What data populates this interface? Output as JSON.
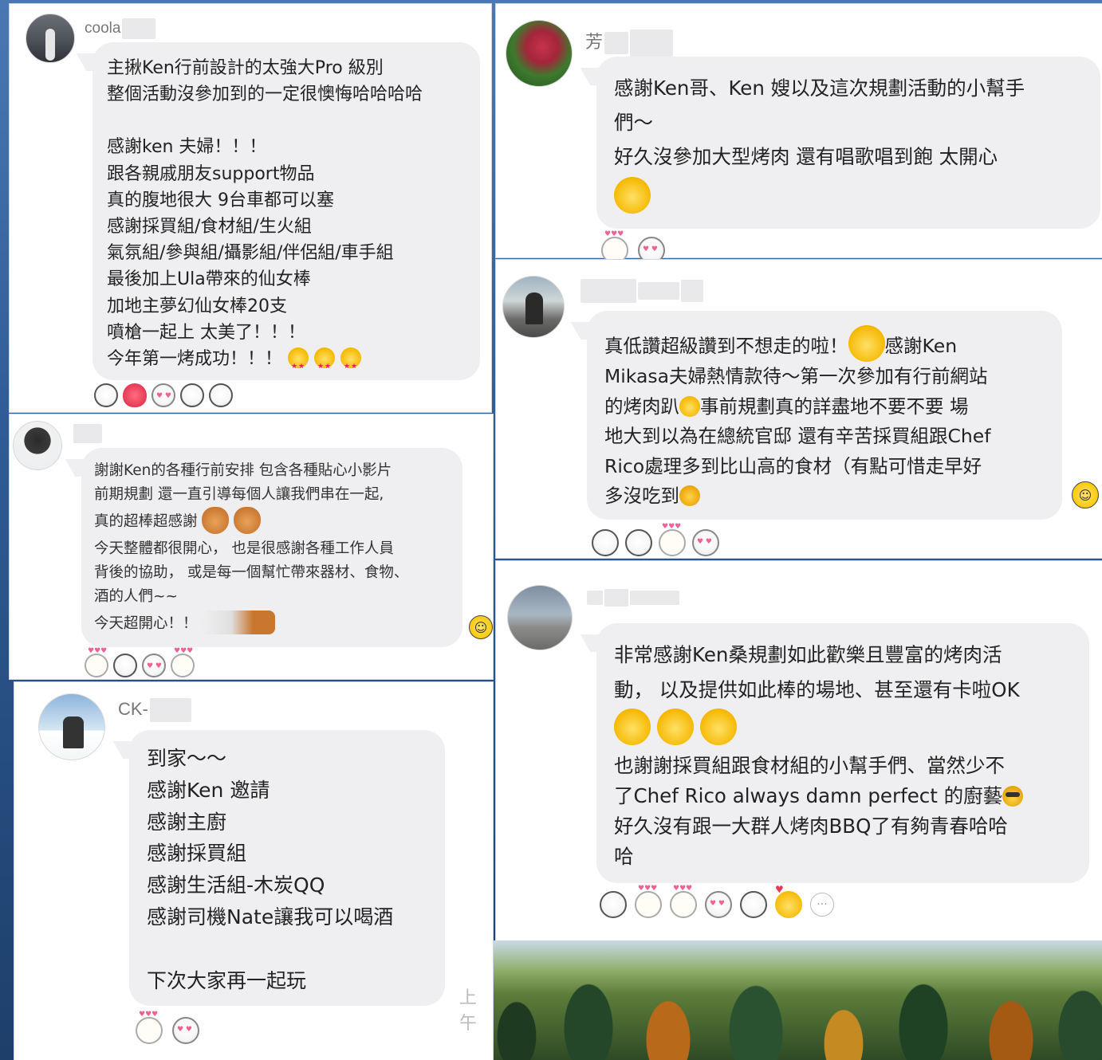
{
  "posts": [
    {
      "id": "post-1",
      "author_prefix": "coola",
      "lines": [
        "主揪Ken行前設計的太強大Pro 級別",
        "整個活動沒參加到的一定很懊悔哈哈哈哈",
        "",
        "感謝ken 夫婦！！！",
        "跟各親戚朋友support物品",
        "真的腹地很大 9台車都可以塞",
        "感謝採買組/食材組/生火組",
        "氣氛組/參與組/攝影組/伴侶組/車手組",
        "最後加上Ula帶來的仙女棒",
        "加地主夢幻仙女棒20支",
        "噴槍一起上 太美了！！！",
        "今年第一烤成功！！！"
      ],
      "trailing_emoji": [
        "star-eyes-emoji",
        "star-eyes-emoji",
        "star-eyes-emoji"
      ],
      "reactions": [
        "laugh-sticker",
        "heart-sticker",
        "love-sticker",
        "laugh-sticker",
        "laugh-sticker"
      ]
    },
    {
      "id": "post-2",
      "author_prefix": "",
      "lines": [
        "謝謝Ken的各種行前安排 包含各種貼心小影片",
        "前期規劃 還一直引導每個人讓我們串在一起,",
        "真的超棒超感謝",
        "今天整體都很開心， 也是很感謝各種工作人員",
        "背後的協助， 或是每一個幫忙帶來器材、食物、",
        "酒的人們~~",
        "今天超開心！！"
      ],
      "reactions": [
        "cat-love-sticker",
        "laugh-sticker",
        "heart-eyes-sticker",
        "cat-sticker"
      ]
    },
    {
      "id": "post-3",
      "author_prefix": "CK-",
      "lines": [
        "到家～～",
        "感謝Ken 邀請",
        "感謝主廚",
        "感謝採買組",
        "感謝生活組-木炭QQ",
        "感謝司機Nate讓我可以喝酒",
        "",
        "下次大家再一起玩"
      ],
      "timestamp": "上午",
      "reactions": [
        "cat-love-sticker",
        "love-sticker"
      ]
    },
    {
      "id": "post-4",
      "author_prefix": "芳",
      "lines": [
        "感謝Ken哥、Ken 嫂以及這次規劃活動的小幫手",
        "們～",
        "好久沒參加大型烤肉 還有唱歌唱到飽 太開心"
      ],
      "reactions": [
        "cat-love-sticker",
        "love-sticker"
      ]
    },
    {
      "id": "post-5",
      "author_prefix": "",
      "lines_html_parts": [
        {
          "text": "真低讚超級讚到不想走的啦！"
        },
        {
          "text": "感謝Ken"
        },
        {
          "text": "Mikasa夫婦熱情款待～第一次參加有行前網站"
        },
        {
          "text": "的烤肉趴"
        },
        {
          "text": "事前規劃真的詳盡地不要不要 場"
        },
        {
          "text": "地大到以為在總統官邸 還有辛苦採買組跟Chef"
        },
        {
          "text": "Rico處理多到比山高的食材（有點可惜走早好"
        },
        {
          "text": "多沒吃到"
        }
      ],
      "reactions": [
        "laugh-sticker",
        "laugh-sticker",
        "cat-love-sticker",
        "love-sticker"
      ]
    },
    {
      "id": "post-6",
      "author_prefix": "",
      "lines": [
        "非常感謝Ken桑規劃如此歡樂且豐富的烤肉活",
        "動， 以及提供如此棒的場地、甚至還有卡啦OK",
        "也謝謝採買組跟食材組的小幫手們、當然少不",
        "了Chef Rico always damn perfect 的廚藝",
        "好久沒有跟一大群人烤肉BBQ了有夠青春哈哈",
        "哈"
      ],
      "reactions": [
        "laugh-sticker",
        "bunny-sticker",
        "cat-love-sticker",
        "love-sticker",
        "laugh-sticker",
        "chick-love-sticker",
        "more-button"
      ]
    }
  ],
  "icons": {
    "smile_button": "☺",
    "more": "···"
  },
  "colors": {
    "bubble": "#efeff1",
    "panel": "#ffffff",
    "background": "#2f5c96"
  }
}
